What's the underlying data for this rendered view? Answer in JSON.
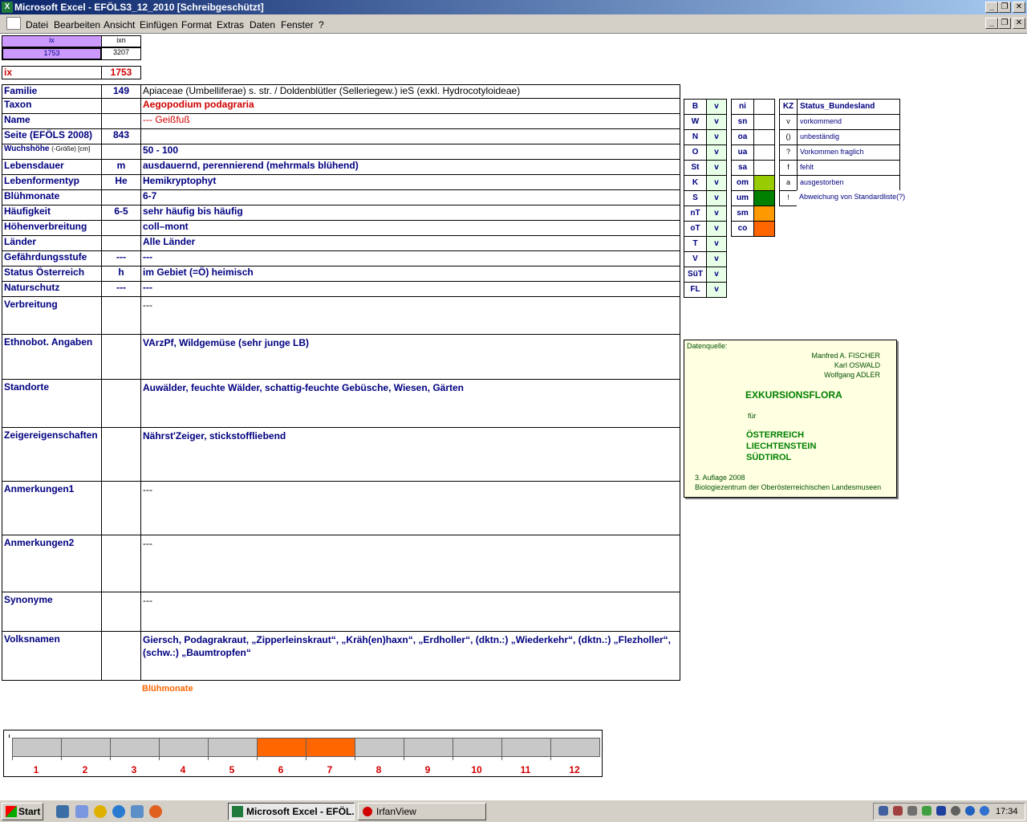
{
  "window": {
    "title": "Microsoft Excel - EFÖLS3_12_2010  [Schreibgeschützt]",
    "app_icon": "excel-icon"
  },
  "menu": [
    "Datei",
    "Bearbeiten",
    "Ansicht",
    "Einfügen",
    "Format",
    "Extras",
    "Daten",
    "Fenster",
    "?"
  ],
  "top": {
    "ix_label": "ix",
    "ixn_label": "ixn",
    "ix_value": "1753",
    "ixn_value": "3207",
    "ix2_label": "ix",
    "ix2_value": "1753"
  },
  "rows": [
    {
      "label": "Familie",
      "code": "149",
      "value": "Apiaceae (Umbelliferae) s. str.  /  Doldenblütler (Selleriegew.) ieS (exkl. Hydrocotyloideae)"
    },
    {
      "label": "Taxon",
      "code": "",
      "value": "Aegopodium podagraria"
    },
    {
      "label": "Name",
      "code": "",
      "value": "--- Geißfuß"
    },
    {
      "label": "Seite (EFÖLS 2008)",
      "code": "843",
      "value": ""
    },
    {
      "label": "Wuchshöhe",
      "label_extra": "(-Größe) [cm]",
      "code": "",
      "value": "50 - 100"
    },
    {
      "label": "Lebensdauer",
      "code": "m",
      "value": "ausdauernd, perennierend (mehrmals blühend)"
    },
    {
      "label": "Lebenformentyp",
      "code": "He",
      "value": "Hemikryptophyt"
    },
    {
      "label": "Blühmonate",
      "code": "",
      "value": "6-7"
    },
    {
      "label": "Häufigkeit",
      "code": "6-5",
      "value": "sehr häufig bis häufig"
    },
    {
      "label": "Höhenverbreitung",
      "code": "",
      "value": "coll–mont"
    },
    {
      "label": "Länder",
      "code": "",
      "value": "Alle Länder"
    },
    {
      "label": "Gefährdungsstufe",
      "code": "---",
      "value": "---"
    },
    {
      "label": "Status Österreich",
      "code": "h",
      "value": "im Gebiet (=Ö) heimisch"
    },
    {
      "label": "Naturschutz",
      "code": "---",
      "value": "---"
    }
  ],
  "big_rows": [
    {
      "label": "Verbreitung",
      "value": "---"
    },
    {
      "label": "Ethnobot. Angaben",
      "value": "VArzPf, Wildgemüse (sehr junge LB)"
    },
    {
      "label": "Standorte",
      "value": "Auwälder, feuchte Wälder, schattig-feuchte Gebüsche, Wiesen, Gärten"
    },
    {
      "label": "Zeigereigenschaften",
      "value": "Nährst'Zeiger, stickstoffliebend"
    },
    {
      "label": "Anmerkungen1",
      "value": "---"
    },
    {
      "label": "Anmerkungen2",
      "value": "---"
    },
    {
      "label": "Synonyme",
      "value": "---"
    },
    {
      "label": "Volksnamen",
      "value": "Giersch, Podagrakraut, „Zipperleinskraut“, „Kräh(en)haxn“, „Erdholler“,  (dktn.:) „Wiederkehr“, (dktn.:) „Flezholler“, (schw.:) „Baumtropfen“"
    }
  ],
  "states": [
    {
      "k": "B",
      "v": "v"
    },
    {
      "k": "W",
      "v": "v"
    },
    {
      "k": "N",
      "v": "v"
    },
    {
      "k": "O",
      "v": "v"
    },
    {
      "k": "St",
      "v": "v"
    },
    {
      "k": "K",
      "v": "v"
    },
    {
      "k": "S",
      "v": "v"
    },
    {
      "k": "nT",
      "v": "v"
    },
    {
      "k": "oT",
      "v": "v"
    },
    {
      "k": "T",
      "v": "v"
    },
    {
      "k": "V",
      "v": "v"
    },
    {
      "k": "SüT",
      "v": "v"
    },
    {
      "k": "FL",
      "v": "v"
    }
  ],
  "altitude": [
    {
      "k": "ni",
      "color": "#ffffff"
    },
    {
      "k": "sn",
      "color": "#ffffff"
    },
    {
      "k": "oa",
      "color": "#ffffff"
    },
    {
      "k": "ua",
      "color": "#ffffff"
    },
    {
      "k": "sa",
      "color": "#ffffff"
    },
    {
      "k": "om",
      "color": "#99cc00"
    },
    {
      "k": "um",
      "color": "#008000"
    },
    {
      "k": "sm",
      "color": "#ff9900"
    },
    {
      "k": "co",
      "color": "#ff6600"
    }
  ],
  "legend": {
    "head_k": "KZ",
    "head_t": "Status_Bundesland",
    "items": [
      {
        "k": "v",
        "t": "vorkommend"
      },
      {
        "k": "()",
        "t": "unbeständig"
      },
      {
        "k": "?",
        "t": "Vorkommen fraglich"
      },
      {
        "k": "f",
        "t": "fehlt"
      },
      {
        "k": "a",
        "t": "ausgestorben"
      },
      {
        "k": "!",
        "t": "Abweichung von Standardliste(?)"
      }
    ]
  },
  "source": {
    "label": "Datenquelle:",
    "authors": [
      "Manfred A. FISCHER",
      "Karl OSWALD",
      "Wolfgang ADLER"
    ],
    "title": "EXKURSIONSFLORA",
    "fuer": "für",
    "regions": [
      "ÖSTERREICH",
      "LIECHTENSTEIN",
      "SÜDTIROL"
    ],
    "edition": "3. Auflage 2008",
    "publisher": "Biologiezentrum der Oberösterreichischen Landesmuseen"
  },
  "bloom_chart": {
    "title": "Blühmonate",
    "months": [
      "1",
      "2",
      "3",
      "4",
      "5",
      "6",
      "7",
      "8",
      "9",
      "10",
      "11",
      "12"
    ],
    "active": [
      6,
      7
    ],
    "active_color": "#ff6600",
    "inactive_color": "#c8c8c8"
  },
  "taskbar": {
    "start": "Start",
    "tasks": [
      "Microsoft Excel - EFÖL...",
      "IrfanView"
    ],
    "clock": "17:34"
  }
}
